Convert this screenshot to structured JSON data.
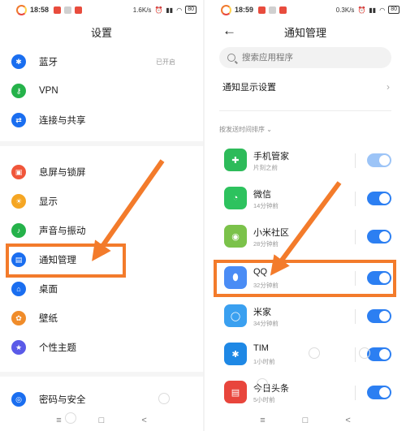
{
  "left": {
    "status": {
      "time": "18:58",
      "speed": "1.6K/s",
      "battery": "80"
    },
    "title": "设置",
    "items": [
      {
        "label": "蓝牙",
        "value": "已开启",
        "icon": "bluetooth-icon",
        "color": "#1a6ef0",
        "glyph": "✱"
      },
      {
        "label": "VPN",
        "value": "",
        "icon": "vpn-key-icon",
        "color": "#25b24a",
        "glyph": "⚷"
      },
      {
        "label": "连接与共享",
        "value": "",
        "icon": "share-icon",
        "color": "#1a6ef0",
        "glyph": "⇄"
      },
      {
        "label": "息屏与锁屏",
        "value": "",
        "icon": "lock-icon",
        "color": "#f0563a",
        "glyph": "▣"
      },
      {
        "label": "显示",
        "value": "",
        "icon": "display-brightness-icon",
        "color": "#f5a623",
        "glyph": "☀"
      },
      {
        "label": "声音与振动",
        "value": "",
        "icon": "sound-icon",
        "color": "#25b24a",
        "glyph": "♪"
      },
      {
        "label": "通知管理",
        "value": "",
        "icon": "notification-icon",
        "color": "#1a6ef0",
        "glyph": "▤"
      },
      {
        "label": "桌面",
        "value": "",
        "icon": "home-desktop-icon",
        "color": "#1a6ef0",
        "glyph": "⌂"
      },
      {
        "label": "壁纸",
        "value": "",
        "icon": "wallpaper-icon",
        "color": "#f08c2a",
        "glyph": "✿"
      },
      {
        "label": "个性主题",
        "value": "",
        "icon": "theme-icon",
        "color": "#5a5ae8",
        "glyph": "★"
      },
      {
        "label": "密码与安全",
        "value": "",
        "icon": "password-security-icon",
        "color": "#1a6ef0",
        "glyph": "◎"
      }
    ],
    "nav": [
      "≡",
      "□",
      "<"
    ]
  },
  "right": {
    "status": {
      "time": "18:59",
      "speed": "0.3K/s",
      "battery": "80"
    },
    "title": "通知管理",
    "back": "←",
    "search_placeholder": "搜索应用程序",
    "display_settings": "通知显示设置",
    "sort_label": "按发送时间排序",
    "apps": [
      {
        "name": "手机管家",
        "time": "片刻之前",
        "icon": "security-manager-icon",
        "color": "#2dbb5a",
        "glyph": "✚",
        "enabled": true,
        "dim": true
      },
      {
        "name": "微信",
        "time": "14分钟前",
        "icon": "wechat-icon",
        "color": "#2dc25e",
        "glyph": "◔",
        "enabled": true,
        "dim": false
      },
      {
        "name": "小米社区",
        "time": "28分钟前",
        "icon": "mi-community-icon",
        "color": "#7bc24a",
        "glyph": "◉",
        "enabled": true,
        "dim": false
      },
      {
        "name": "QQ",
        "time": "32分钟前",
        "icon": "qq-penguin-icon",
        "color": "#4a8cf5",
        "glyph": "⬮",
        "enabled": true,
        "dim": false
      },
      {
        "name": "米家",
        "time": "34分钟前",
        "icon": "mijia-icon",
        "color": "#3aa0f0",
        "glyph": "◯",
        "enabled": true,
        "dim": false
      },
      {
        "name": "TIM",
        "time": "1小时前",
        "icon": "tim-icon",
        "color": "#1e88e5",
        "glyph": "✱",
        "enabled": true,
        "dim": false
      },
      {
        "name": "今日头条",
        "time": "5小时前",
        "icon": "toutiao-icon",
        "color": "#e8453c",
        "glyph": "▤",
        "enabled": true,
        "dim": false
      }
    ],
    "nav": [
      "≡",
      "□",
      "<"
    ]
  },
  "colors": {
    "accent": "#2c7ff2",
    "annotation": "#f37b2b"
  }
}
